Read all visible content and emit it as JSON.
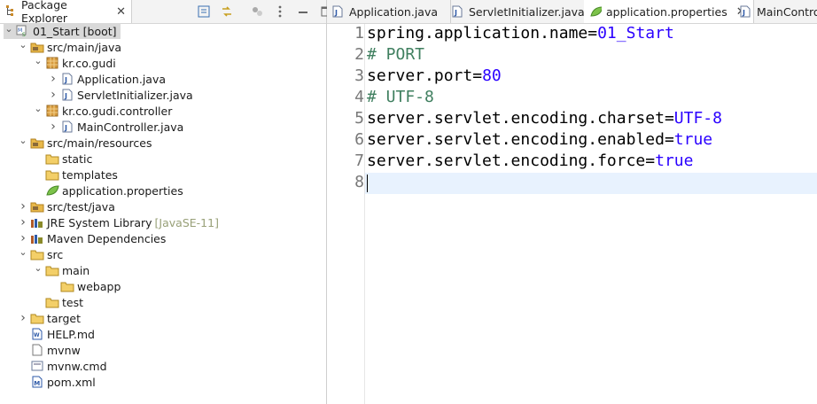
{
  "package_explorer": {
    "tab_label": "Package Explorer",
    "close_glyph": "✕",
    "tree": [
      {
        "label": "01_Start [boot]",
        "icon": "project-icon",
        "twisty": "open",
        "level": 0
      },
      {
        "label": "src/main/java",
        "icon": "source-folder-icon",
        "twisty": "open",
        "level": 1
      },
      {
        "label": "kr.co.gudi",
        "icon": "package-icon",
        "twisty": "open",
        "level": 2
      },
      {
        "label": "Application.java",
        "icon": "java-file-icon",
        "twisty": "closed",
        "level": 3
      },
      {
        "label": "ServletInitializer.java",
        "icon": "java-file-icon",
        "twisty": "closed",
        "level": 3
      },
      {
        "label": "kr.co.gudi.controller",
        "icon": "package-icon",
        "twisty": "open",
        "level": 2
      },
      {
        "label": "MainController.java",
        "icon": "java-file-icon",
        "twisty": "closed",
        "level": 3
      },
      {
        "label": "src/main/resources",
        "icon": "source-folder-icon",
        "twisty": "open",
        "level": 1
      },
      {
        "label": "static",
        "icon": "folder-icon",
        "twisty": "none",
        "level": 2
      },
      {
        "label": "templates",
        "icon": "folder-icon",
        "twisty": "none",
        "level": 2
      },
      {
        "label": "application.properties",
        "icon": "properties-file-icon",
        "twisty": "none",
        "level": 2
      },
      {
        "label": "src/test/java",
        "icon": "source-folder-icon",
        "twisty": "closed",
        "level": 1
      },
      {
        "label": "JRE System Library",
        "icon": "library-icon",
        "twisty": "closed",
        "level": 1,
        "decoration": "[JavaSE-11]"
      },
      {
        "label": "Maven Dependencies",
        "icon": "library-icon",
        "twisty": "closed",
        "level": 1
      },
      {
        "label": "src",
        "icon": "folder-icon",
        "twisty": "open",
        "level": 1
      },
      {
        "label": "main",
        "icon": "folder-icon",
        "twisty": "open",
        "level": 2
      },
      {
        "label": "webapp",
        "icon": "folder-icon",
        "twisty": "none",
        "level": 3
      },
      {
        "label": "test",
        "icon": "folder-icon",
        "twisty": "none",
        "level": 2
      },
      {
        "label": "target",
        "icon": "folder-icon",
        "twisty": "closed",
        "level": 1
      },
      {
        "label": "HELP.md",
        "icon": "text-file-icon",
        "twisty": "none",
        "level": 1
      },
      {
        "label": "mvnw",
        "icon": "file-icon",
        "twisty": "none",
        "level": 1
      },
      {
        "label": "mvnw.cmd",
        "icon": "cmd-file-icon",
        "twisty": "none",
        "level": 1
      },
      {
        "label": "pom.xml",
        "icon": "maven-file-icon",
        "twisty": "none",
        "level": 1
      }
    ]
  },
  "editor": {
    "tabs": [
      {
        "label": "Application.java",
        "icon": "java-file-icon",
        "active": false
      },
      {
        "label": "ServletInitializer.java",
        "icon": "java-file-icon",
        "active": false
      },
      {
        "label": "application.properties",
        "icon": "properties-file-icon",
        "active": true,
        "close": "✕"
      },
      {
        "label": "MainControlle",
        "icon": "java-file-icon",
        "active": false
      }
    ],
    "lines": [
      {
        "n": "1",
        "key": "spring.application.name",
        "eq": "=",
        "val": "01_Start"
      },
      {
        "n": "2",
        "comment": "# PORT"
      },
      {
        "n": "3",
        "key": "server.port",
        "eq": "=",
        "val": "80"
      },
      {
        "n": "4",
        "comment": "# UTF-8"
      },
      {
        "n": "5",
        "key": "server.servlet.encoding.charset",
        "eq": "=",
        "val": "UTF-8"
      },
      {
        "n": "6",
        "key": "server.servlet.encoding.enabled",
        "eq": "=",
        "val": "true"
      },
      {
        "n": "7",
        "key": "server.servlet.encoding.force",
        "eq": "=",
        "val": "true"
      },
      {
        "n": "8"
      }
    ]
  },
  "colors": {
    "value": "#2a00ff",
    "comment": "#3f7f5f",
    "current_line": "#e8f2fe",
    "decoration": "#98a078"
  }
}
